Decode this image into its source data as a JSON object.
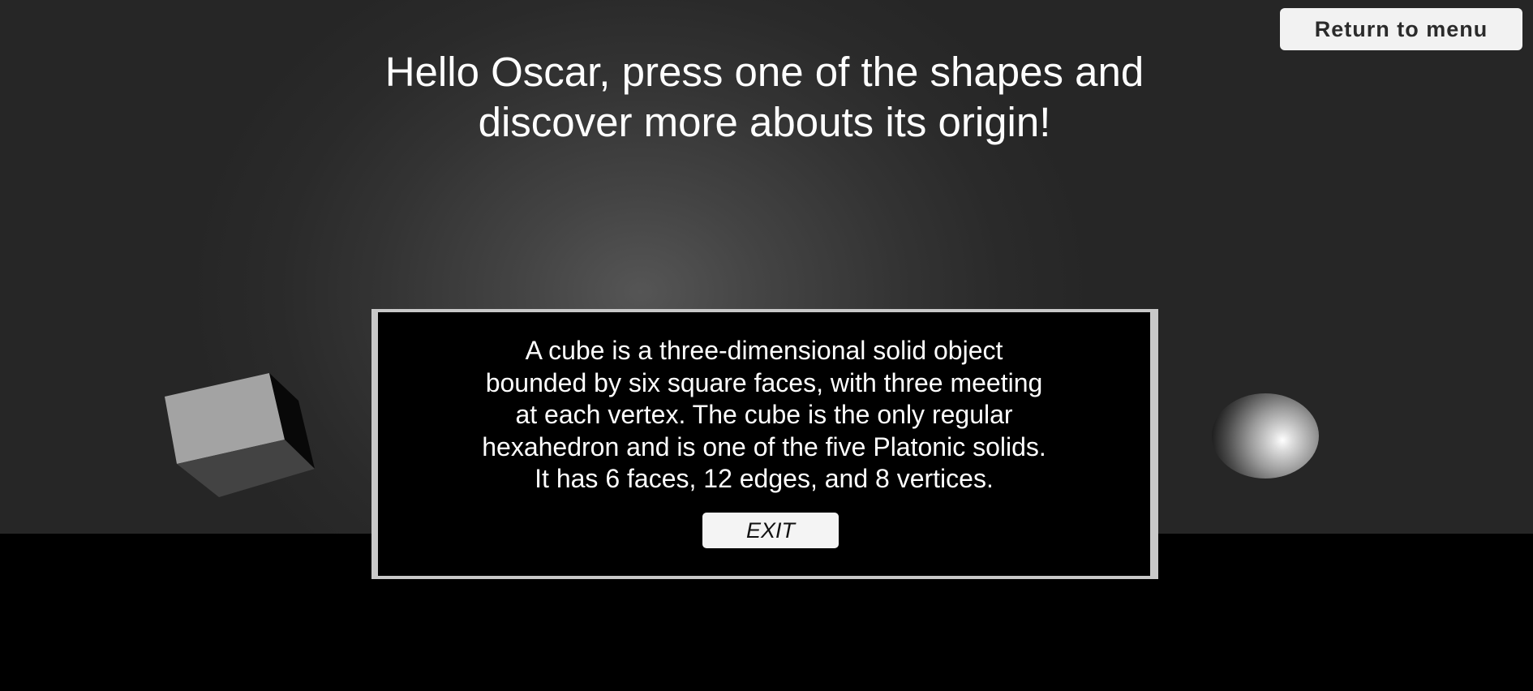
{
  "header": {
    "menu_button_label": "Return to menu",
    "heading_line1": "Hello Oscar, press one of the shapes and",
    "heading_line2": "discover more abouts its origin!"
  },
  "scene": {
    "shapes": [
      {
        "shape": "cube",
        "color": "#a3a3a3"
      },
      {
        "shape": "sphere",
        "color": "#bfbfbf"
      }
    ],
    "background_color": "#2a2a2a",
    "floor_color": "#000000"
  },
  "info_panel": {
    "lines": [
      "A cube is a three-dimensional solid object",
      "bounded by six square faces, with three meeting",
      "at each vertex. The cube is the only regular",
      "hexahedron and is one of the five Platonic solids.",
      "It has 6 faces, 12 edges, and 8 vertices."
    ],
    "exit_label": "EXIT"
  }
}
